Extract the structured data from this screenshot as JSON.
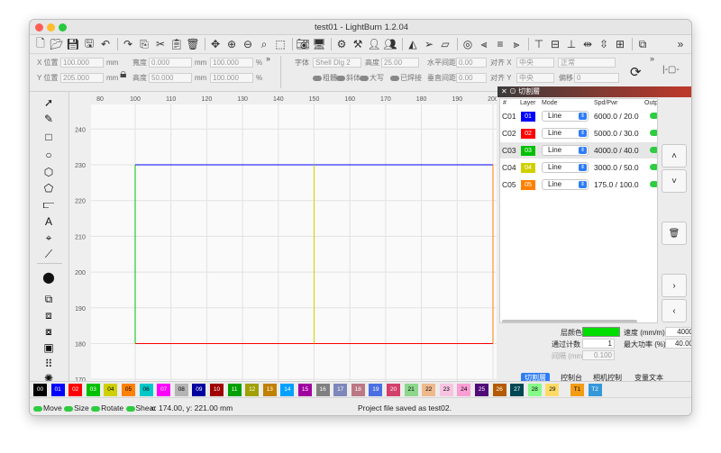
{
  "window": {
    "title": "test01 - LightBurn 1.2.04"
  },
  "toolbar": {
    "icons": [
      "new-file-icon",
      "open-folder-icon",
      "save-icon",
      "save-as-icon",
      "undo-icon",
      "redo-icon",
      "copy-icon",
      "cut-icon",
      "paste-icon",
      "delete-icon",
      "move-icon",
      "zoom-in-icon",
      "zoom-out-icon",
      "zoom-fit-icon",
      "select-frame-icon",
      "camera-icon",
      "monitor-icon",
      "settings-gear-icon",
      "tools-icon",
      "user-icon",
      "user-alt-icon",
      "trace-icon",
      "send-icon",
      "arrange-icon",
      "target-icon",
      "align-left-icon",
      "align-center-icon",
      "align-right-icon",
      "align-top-icon",
      "align-middle-icon",
      "align-bottom-icon",
      "dist-h-icon",
      "dist-v-icon",
      "move-together-icon",
      "group-icon"
    ],
    "overflow": "»"
  },
  "props": {
    "x_label": "X 位置",
    "x_value": "100.000",
    "x_unit": "mm",
    "y_label": "Y 位置",
    "y_value": "205.000",
    "y_unit": "mm",
    "w_label": "寬度",
    "w_value": "0.000",
    "w_unit": "mm",
    "w_pct": "100.000",
    "w_pct_unit": "%",
    "h_label": "高度",
    "h_value": "50.000",
    "h_unit": "mm",
    "h_pct": "100.000",
    "h_pct_unit": "%",
    "font_label": "字体",
    "font_value": "Shell Dlg 2",
    "height_label": "高度",
    "height_value": "25.00",
    "hspace_label": "水平间距",
    "hspace_value": "0.00",
    "alignx_label": "对齐 X",
    "alignx_value": "中央",
    "style_value": "正常",
    "vspace_label": "垂直间距",
    "vspace_value": "0.00",
    "aligny_label": "对齐 Y",
    "aligny_value": "中央",
    "offset_label": "偏移",
    "offset_value": "0",
    "bold_label": "粗體",
    "italic_label": "斜体",
    "upper_label": "大写",
    "welded_label": "已焊接"
  },
  "ruler": {
    "x_ticks": [
      "80",
      "100",
      "110",
      "120",
      "130",
      "140",
      "150",
      "160",
      "170",
      "180",
      "190",
      "200"
    ],
    "y_ticks": [
      "240",
      "230",
      "220",
      "210",
      "200",
      "190",
      "180",
      "170"
    ]
  },
  "layers_panel": {
    "title": "切割層",
    "headers": [
      "#",
      "Layer",
      "Mode",
      "Spd/Pwr",
      "Output"
    ],
    "rows": [
      {
        "id": "C01",
        "num": "01",
        "color": "#0000ff",
        "mode": "Line",
        "spd_pwr": "6000.0 / 20.0"
      },
      {
        "id": "C02",
        "num": "02",
        "color": "#ff0000",
        "mode": "Line",
        "spd_pwr": "5000.0 / 30.0"
      },
      {
        "id": "C03",
        "num": "03",
        "color": "#00c000",
        "mode": "Line",
        "spd_pwr": "4000.0 / 40.0"
      },
      {
        "id": "C04",
        "num": "04",
        "color": "#d0d000",
        "mode": "Line",
        "spd_pwr": "3000.0 / 50.0"
      },
      {
        "id": "C05",
        "num": "05",
        "color": "#ff8000",
        "mode": "Line",
        "spd_pwr": "175.0 / 100.0"
      }
    ],
    "layer_color_label": "层颜色",
    "layer_color": "#00dd00",
    "speed_label": "速度 (mm/m)",
    "speed_value": "4000",
    "passes_label": "通过计数",
    "passes_value": "1",
    "power_label": "最大功率 (%)",
    "power_value": "40.00",
    "interval_label": "间隔 (mm)",
    "interval_value": "0.100"
  },
  "tabs": [
    "切割層",
    "控制台",
    "相机控制",
    "变量文本"
  ],
  "palette": [
    {
      "n": "00",
      "c": "#000000",
      "t": "#fff"
    },
    {
      "n": "01",
      "c": "#0000ff",
      "t": "#fff"
    },
    {
      "n": "02",
      "c": "#ff0000",
      "t": "#fff"
    },
    {
      "n": "03",
      "c": "#00c000",
      "t": "#fff"
    },
    {
      "n": "04",
      "c": "#d0d000",
      "t": "#000"
    },
    {
      "n": "05",
      "c": "#ff8000",
      "t": "#000"
    },
    {
      "n": "06",
      "c": "#00c8c8",
      "t": "#000"
    },
    {
      "n": "07",
      "c": "#ff00ff",
      "t": "#fff"
    },
    {
      "n": "08",
      "c": "#b4b4b4",
      "t": "#000"
    },
    {
      "n": "09",
      "c": "#0000a0",
      "t": "#fff"
    },
    {
      "n": "10",
      "c": "#a00000",
      "t": "#fff"
    },
    {
      "n": "11",
      "c": "#00a000",
      "t": "#fff"
    },
    {
      "n": "12",
      "c": "#a0a000",
      "t": "#fff"
    },
    {
      "n": "13",
      "c": "#c08000",
      "t": "#fff"
    },
    {
      "n": "14",
      "c": "#00a0ff",
      "t": "#fff"
    },
    {
      "n": "15",
      "c": "#a000a0",
      "t": "#fff"
    },
    {
      "n": "16",
      "c": "#808080",
      "t": "#fff"
    },
    {
      "n": "17",
      "c": "#7d87b9",
      "t": "#fff"
    },
    {
      "n": "18",
      "c": "#bb7784",
      "t": "#fff"
    },
    {
      "n": "19",
      "c": "#4a6fe3",
      "t": "#fff"
    },
    {
      "n": "20",
      "c": "#d33f6a",
      "t": "#fff"
    },
    {
      "n": "21",
      "c": "#8cd78c",
      "t": "#000"
    },
    {
      "n": "22",
      "c": "#f0b98d",
      "t": "#000"
    },
    {
      "n": "23",
      "c": "#f6c4e1",
      "t": "#000"
    },
    {
      "n": "24",
      "c": "#fa9ed4",
      "t": "#000"
    },
    {
      "n": "25",
      "c": "#500a78",
      "t": "#fff"
    },
    {
      "n": "26",
      "c": "#b45a00",
      "t": "#fff"
    },
    {
      "n": "27",
      "c": "#004754",
      "t": "#fff"
    },
    {
      "n": "28",
      "c": "#86fa88",
      "t": "#000"
    },
    {
      "n": "29",
      "c": "#ffdb66",
      "t": "#000"
    },
    {
      "n": "T1",
      "c": "#f39c12",
      "t": "#000"
    },
    {
      "n": "T2",
      "c": "#3498db",
      "t": "#fff"
    }
  ],
  "status": {
    "move": "Move",
    "size": "Size",
    "rotate": "Rotate",
    "shear": "Shear",
    "coords": "x: 174.00, y: 221.00 mm",
    "message": "Project file saved as test02."
  }
}
